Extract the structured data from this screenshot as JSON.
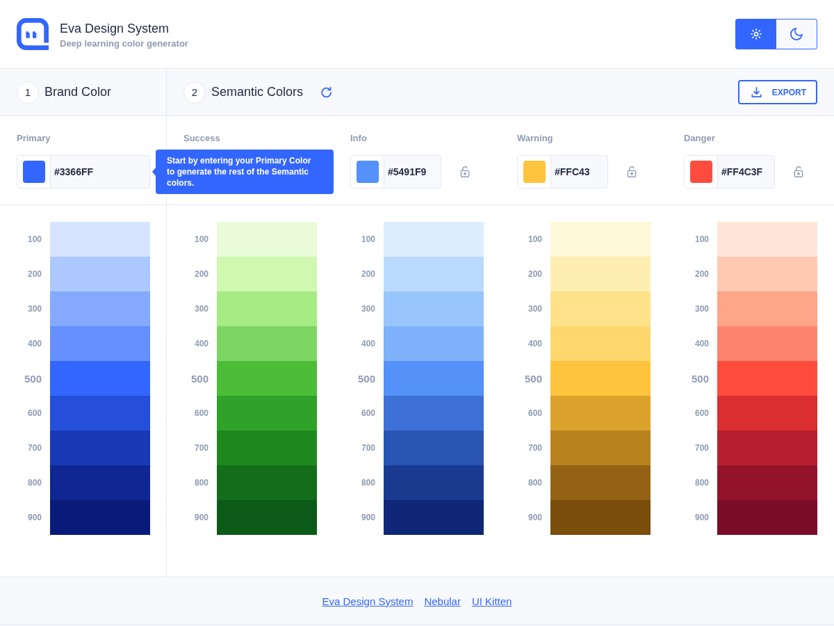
{
  "header": {
    "title": "Eva Design System",
    "subtitle": "Deep learning color generator",
    "theme_toggle": [
      {
        "kind": "light",
        "selected": true
      },
      {
        "kind": "dark",
        "selected": false
      }
    ]
  },
  "steps": [
    {
      "number": "1",
      "title": "Brand Color"
    },
    {
      "number": "2",
      "title": "Semantic Colors"
    }
  ],
  "export_button": {
    "label": "EXPORT"
  },
  "tooltip": {
    "text": "Start by entering your Primary Color to generate the rest of the Semantic colors."
  },
  "brand_palette": {
    "label": "Primary",
    "color": "#3366ff",
    "hex": "#3366FF",
    "shades": [
      {
        "label": "100",
        "color": "#d6e4ff",
        "base": false
      },
      {
        "label": "200",
        "color": "#adc8ff",
        "base": false
      },
      {
        "label": "300",
        "color": "#84a9ff",
        "base": false
      },
      {
        "label": "400",
        "color": "#6690ff",
        "base": false
      },
      {
        "label": "500",
        "color": "#3366ff",
        "base": true
      },
      {
        "label": "600",
        "color": "#254edb",
        "base": false
      },
      {
        "label": "700",
        "color": "#1939b7",
        "base": false
      },
      {
        "label": "800",
        "color": "#102693",
        "base": false
      },
      {
        "label": "900",
        "color": "#091a7a",
        "base": false
      }
    ]
  },
  "semantic_palettes": [
    {
      "label": "Success",
      "shades": [
        {
          "label": "100",
          "color": "#eafbda",
          "base": false
        },
        {
          "label": "200",
          "color": "#d0f8b0",
          "base": false
        },
        {
          "label": "300",
          "color": "#a6eb83",
          "base": false
        },
        {
          "label": "400",
          "color": "#7dd663",
          "base": false
        },
        {
          "label": "500",
          "color": "#4cbd37",
          "base": true
        },
        {
          "label": "600",
          "color": "#2fa229",
          "base": false
        },
        {
          "label": "700",
          "color": "#1e881f",
          "base": false
        },
        {
          "label": "800",
          "color": "#136d1a",
          "base": false
        },
        {
          "label": "900",
          "color": "#0b5a17",
          "base": false
        }
      ]
    },
    {
      "label": "Info",
      "color": "#5491f9",
      "hex": "#5491F9",
      "locked": false,
      "shades": [
        {
          "label": "100",
          "color": "#dcedfe",
          "base": false
        },
        {
          "label": "200",
          "color": "#badafd",
          "base": false
        },
        {
          "label": "300",
          "color": "#98c6fc",
          "base": false
        },
        {
          "label": "400",
          "color": "#7eb2fa",
          "base": false
        },
        {
          "label": "500",
          "color": "#5491f9",
          "base": true
        },
        {
          "label": "600",
          "color": "#3d71d6",
          "base": false
        },
        {
          "label": "700",
          "color": "#2a54b3",
          "base": false
        },
        {
          "label": "800",
          "color": "#1a3a90",
          "base": false
        },
        {
          "label": "900",
          "color": "#102777",
          "base": false
        }
      ]
    },
    {
      "label": "Warning",
      "color": "#ffc43d",
      "hex": "#FFC43",
      "locked": false,
      "shades": [
        {
          "label": "100",
          "color": "#fff8d8",
          "base": false
        },
        {
          "label": "200",
          "color": "#ffeeb1",
          "base": false
        },
        {
          "label": "300",
          "color": "#ffe28a",
          "base": false
        },
        {
          "label": "400",
          "color": "#ffd76d",
          "base": false
        },
        {
          "label": "500",
          "color": "#ffc43d",
          "base": true
        },
        {
          "label": "600",
          "color": "#dba22c",
          "base": false
        },
        {
          "label": "700",
          "color": "#b7821e",
          "base": false
        },
        {
          "label": "800",
          "color": "#936313",
          "base": false
        },
        {
          "label": "900",
          "color": "#7a4d0b",
          "base": false
        }
      ]
    },
    {
      "label": "Danger",
      "color": "#ff4c3f",
      "hex": "#FF4C3F",
      "locked": false,
      "shades": [
        {
          "label": "100",
          "color": "#ffe6d8",
          "base": false
        },
        {
          "label": "200",
          "color": "#ffc9b1",
          "base": false
        },
        {
          "label": "300",
          "color": "#ffa58a",
          "base": false
        },
        {
          "label": "400",
          "color": "#ff846e",
          "base": false
        },
        {
          "label": "500",
          "color": "#ff4c3f",
          "base": true
        },
        {
          "label": "600",
          "color": "#db2e31",
          "base": false
        },
        {
          "label": "700",
          "color": "#b71f2f",
          "base": false
        },
        {
          "label": "800",
          "color": "#93142a",
          "base": false
        },
        {
          "label": "900",
          "color": "#7a0c27",
          "base": false
        }
      ]
    }
  ],
  "footer": {
    "links": [
      {
        "label": "Eva Design System"
      },
      {
        "label": "Nebular"
      },
      {
        "label": "UI Kitten"
      }
    ]
  }
}
